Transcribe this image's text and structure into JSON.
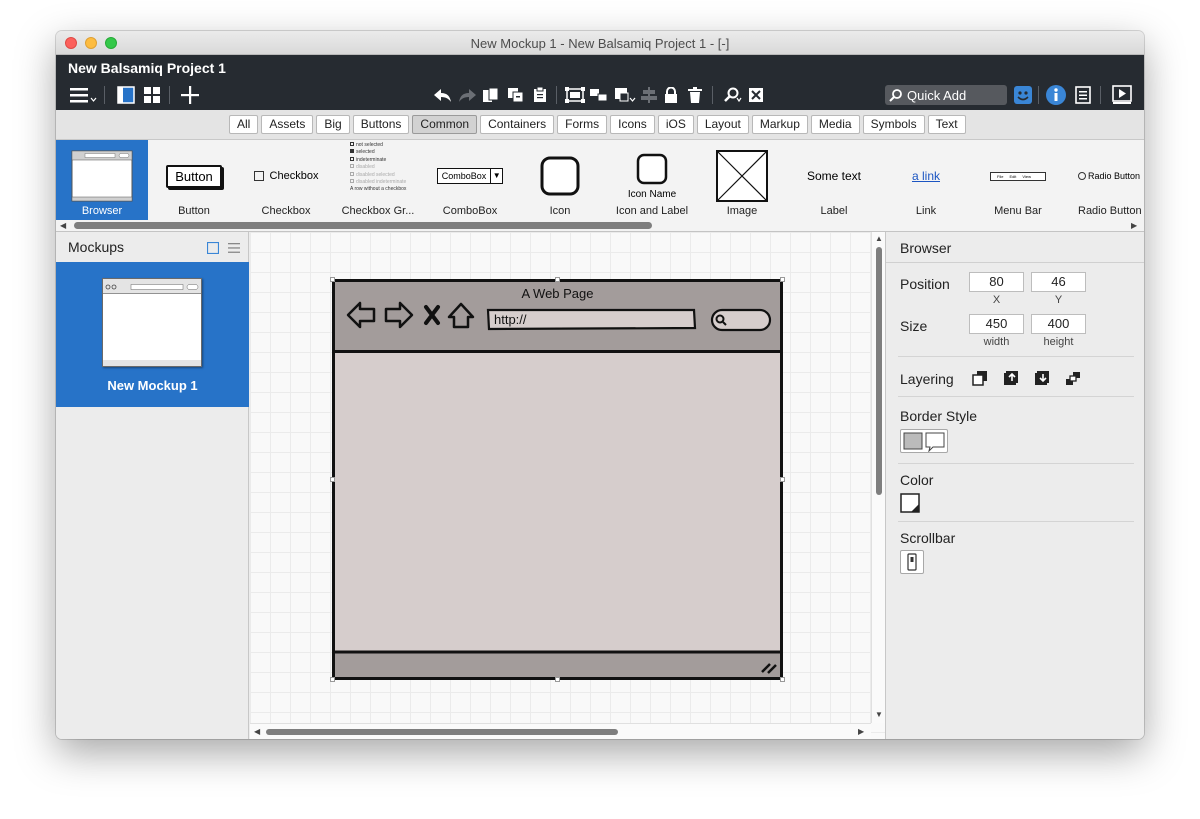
{
  "window": {
    "title": "New Mockup 1 - New Balsamiq Project 1 - [-]"
  },
  "app": {
    "project_name": "New Balsamiq Project 1",
    "quick_add_label": "Quick Add",
    "toolbar_icons": [
      "menu-icon",
      "single-view-icon",
      "grid-view-icon",
      "add-icon",
      "undo-icon",
      "redo-icon",
      "copy-icon",
      "duplicate-icon",
      "paste-icon",
      "group-icon",
      "ungroup-icon",
      "arrange-icon",
      "align-icon",
      "lock-icon",
      "delete-icon",
      "find-icon",
      "close-mockup-icon",
      "search-icon",
      "face-icon",
      "info-icon",
      "notes-icon",
      "presentation-icon"
    ]
  },
  "categories": [
    "All",
    "Assets",
    "Big",
    "Buttons",
    "Common",
    "Containers",
    "Forms",
    "Icons",
    "iOS",
    "Layout",
    "Markup",
    "Media",
    "Symbols",
    "Text"
  ],
  "active_category": "Common",
  "library": {
    "items": [
      {
        "label": "Browser"
      },
      {
        "label": "Button",
        "preview": "Button"
      },
      {
        "label": "Checkbox",
        "preview": "Checkbox"
      },
      {
        "label": "Checkbox Gr...",
        "preview_lines": [
          "not selected",
          "selected",
          "indeterminate",
          "disabled",
          "disabled selected",
          "disabled indeterminate",
          "A row without a checkbox"
        ]
      },
      {
        "label": "ComboBox",
        "preview": "ComboBox"
      },
      {
        "label": "Icon"
      },
      {
        "label": "Icon and Label",
        "preview": "Icon Name"
      },
      {
        "label": "Image"
      },
      {
        "label": "Label",
        "preview": "Some text"
      },
      {
        "label": "Link",
        "preview": "a link"
      },
      {
        "label": "Menu Bar",
        "preview_items": [
          "File",
          "Edit",
          "View"
        ]
      },
      {
        "label": "Radio Button",
        "preview": "Radio Button"
      }
    ]
  },
  "mockups_panel": {
    "title": "Mockups",
    "items": [
      {
        "name": "New Mockup 1"
      }
    ]
  },
  "canvas": {
    "browser": {
      "page_title": "A Web Page",
      "url": "http://"
    }
  },
  "properties": {
    "title": "Browser",
    "position_label": "Position",
    "x": "80",
    "y": "46",
    "x_label": "X",
    "y_label": "Y",
    "size_label": "Size",
    "width": "450",
    "height": "400",
    "width_label": "width",
    "height_label": "height",
    "layering_label": "Layering",
    "border_style_label": "Border Style",
    "color_label": "Color",
    "scrollbar_label": "Scrollbar"
  },
  "colors": {
    "selection": "#2773c8",
    "appbar": "#262b31",
    "browser_chrome": "#a39c9b",
    "browser_body": "#d6cdcc"
  }
}
